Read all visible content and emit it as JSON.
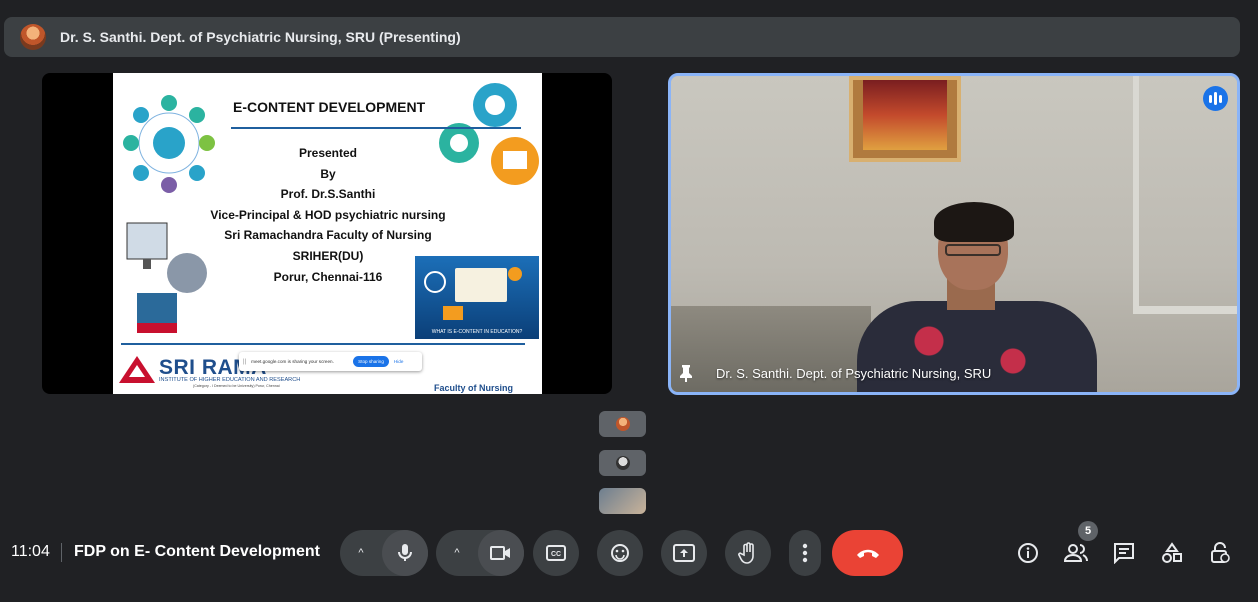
{
  "presenter_bar": {
    "text": "Dr. S. Santhi. Dept. of Psychiatric Nursing, SRU (Presenting)"
  },
  "slide": {
    "title": "E-CONTENT DEVELOPMENT",
    "lines": [
      "Presented",
      "By",
      "Prof. Dr.S.Santhi",
      "Vice-Principal & HOD psychiatric nursing",
      "Sri Ramachandra Faculty of Nursing",
      "SRIHER(DU)",
      "Porur, Chennai-116"
    ],
    "eclass_caption": "WHAT IS E-CONTENT IN EDUCATION?",
    "logo_name": "SRI RAMA",
    "logo_sub": "INSTITUTE OF HIGHER EDUCATION AND RESEARCH",
    "logo_sub2": "(Category - I Deemed to be University) Porur, Chennai",
    "faculty": "Faculty of Nursing"
  },
  "share_banner": {
    "drag": "||",
    "text": "meet.google.com is sharing your screen.",
    "stop_label": "Stop sharing",
    "hide_label": "Hide"
  },
  "video_tile": {
    "name": "Dr. S. Santhi. Dept. of Psychiatric Nursing, SRU"
  },
  "meeting": {
    "time": "11:04",
    "title": "FDP on E- Content Development"
  },
  "people_count": "5",
  "icons": {
    "pin": "pin-icon",
    "speaking": "speaking-indicator-icon",
    "mic": "mic-icon",
    "camera": "camera-icon",
    "captions": "captions-icon",
    "emoji": "emoji-icon",
    "present": "present-icon",
    "hand": "raise-hand-icon",
    "more": "more-options-icon",
    "end_call": "end-call-icon",
    "info": "info-icon",
    "people": "people-icon",
    "chat": "chat-icon",
    "activities": "activities-icon",
    "host_controls": "host-controls-icon"
  },
  "colors": {
    "background": "#202124",
    "control": "#3c4043",
    "end_call": "#ea4335",
    "active_border": "#8ab4f8",
    "accent": "#1a73e8"
  }
}
